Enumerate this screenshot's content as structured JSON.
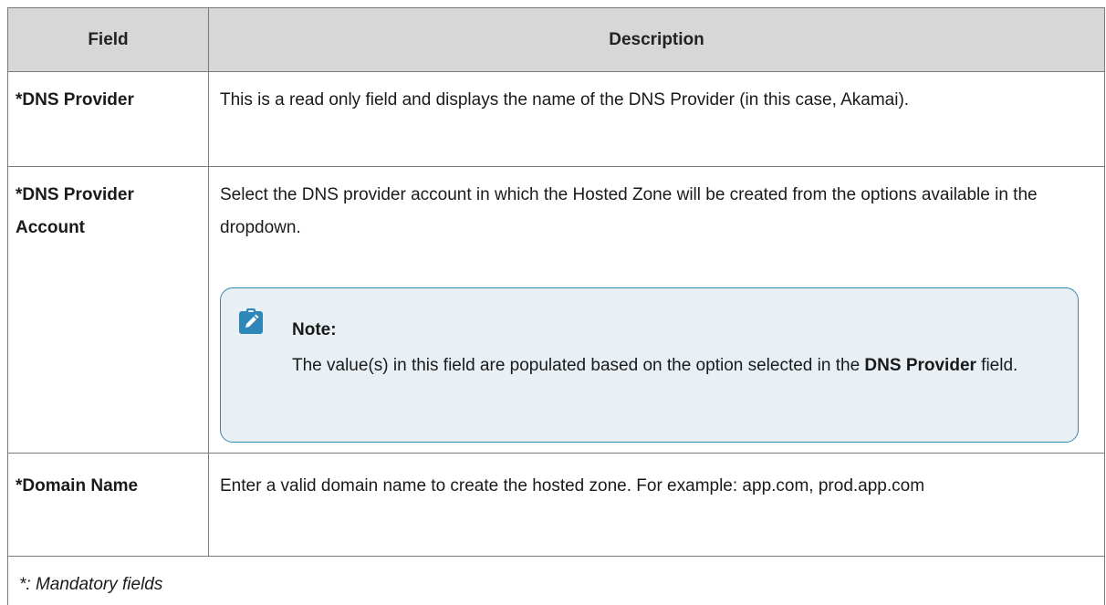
{
  "table": {
    "headers": {
      "field": "Field",
      "description": "Description"
    },
    "rows": [
      {
        "field": "*DNS Provider",
        "description": "This is a read only field and displays the name of the DNS Provider (in this case, Akamai)."
      },
      {
        "field": "*DNS Provider Account",
        "description": "Select the DNS provider account in which the Hosted Zone will be created from the options available in the dropdown.",
        "note": {
          "icon": "pencil-clipboard-icon",
          "title": "Note:",
          "body_prefix": "The value(s) in this field are populated based on the option selected in the ",
          "body_bold": "DNS Provider",
          "body_suffix": " field."
        }
      },
      {
        "field": "*Domain Name",
        "description": "Enter a valid domain name to create the hosted zone. For example: app.com, prod.app.com"
      }
    ],
    "footer": "*: Mandatory fields"
  },
  "colors": {
    "header_bg": "#d7d7d7",
    "border": "#7a7a7a",
    "note_bg": "#e8f0f5",
    "note_border": "#2e87b6",
    "note_icon": "#2e87b6"
  }
}
